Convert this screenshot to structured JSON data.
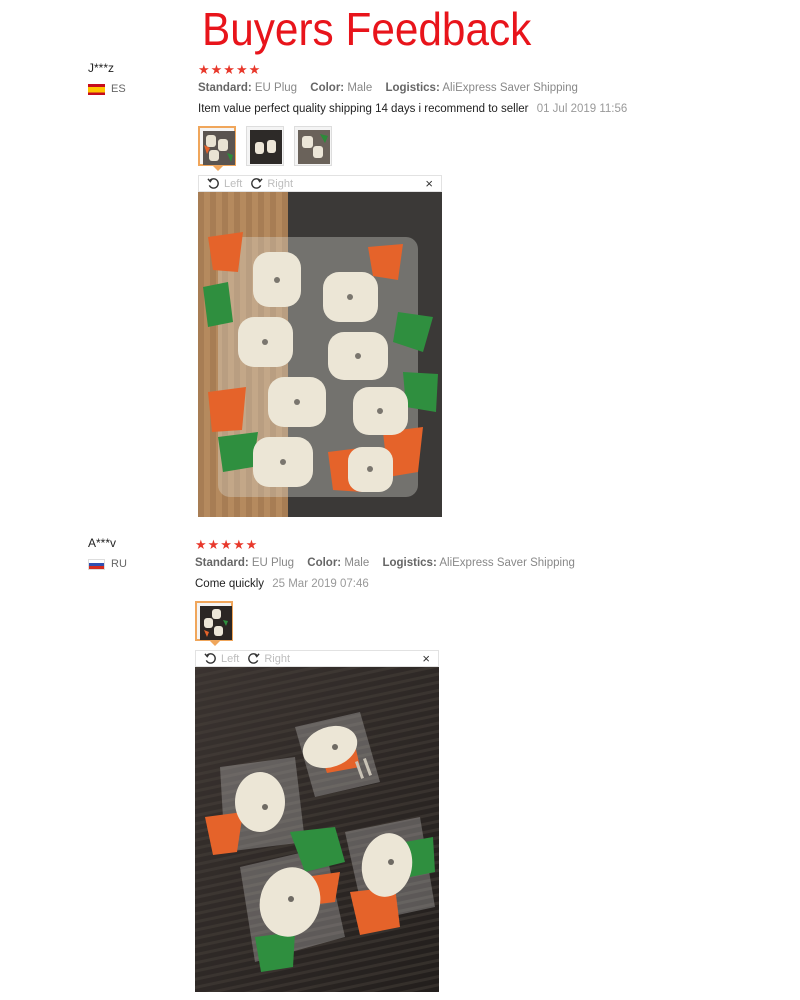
{
  "page": {
    "title": "Buyers Feedback"
  },
  "labels": {
    "standard": "Standard:",
    "color": "Color:",
    "logistics": "Logistics:",
    "rotate_left": "Left",
    "rotate_right": "Right",
    "close": "×"
  },
  "colors": {
    "title": "#e8141b",
    "stars": "#e8382b",
    "thumb_active_border": "#f0a65b"
  },
  "reviews": [
    {
      "user": "J***z",
      "country": "ES",
      "rating": "★★★★★",
      "standard": "EU Plug",
      "color": "Male",
      "logistics": "AliExpress Saver Shipping",
      "comment": "Item value perfect quality shipping 14 days i recommend to seller",
      "date": "01 Jul 2019 11:56",
      "thumbnails": 3
    },
    {
      "user": "A***v",
      "country": "RU",
      "rating": "★★★★★",
      "standard": "EU Plug",
      "color": "Male",
      "logistics": "AliExpress Saver Shipping",
      "comment": "Come quickly",
      "date": "25 Mar 2019 07:46",
      "thumbnails": 1
    }
  ]
}
